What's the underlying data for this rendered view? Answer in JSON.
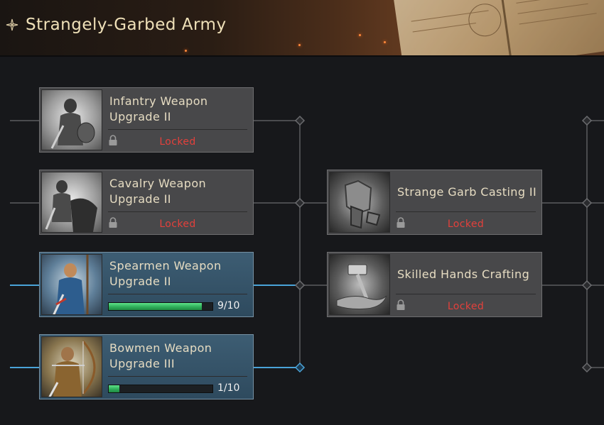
{
  "header": {
    "title": "Strangely-Garbed Army",
    "icon": "compass-star-icon"
  },
  "colors": {
    "locked": "#e3403b",
    "progress": "#2fae5a",
    "active_line": "#4aa3d8",
    "inactive_line": "#4a4b4e"
  },
  "nodes": [
    {
      "title": "Infantry Weapon Upgrade II",
      "status": "Locked",
      "icon": "infantry-soldier-icon"
    },
    {
      "title": "Cavalry Weapon Upgrade II",
      "status": "Locked",
      "icon": "cavalry-rider-icon"
    },
    {
      "title": "Spearmen Weapon Upgrade II",
      "progress_text": "9/10",
      "progress": 0.9,
      "icon": "spearman-icon"
    },
    {
      "title": "Bowmen Weapon Upgrade III",
      "progress_text": "1/10",
      "progress": 0.1,
      "icon": "bowman-icon"
    },
    {
      "title": "Strange Garb Casting II",
      "status": "Locked",
      "icon": "armor-forging-icon"
    },
    {
      "title": "Skilled Hands Crafting",
      "status": "Locked",
      "icon": "hammer-hand-icon"
    }
  ]
}
